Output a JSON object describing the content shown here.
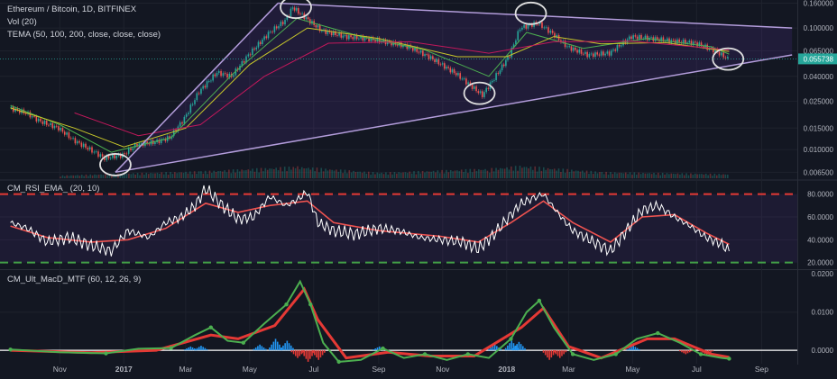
{
  "chart_data": [
    {
      "type": "line",
      "role": "price",
      "title": "Ethereum / Bitcoin, 1D, BITFINEX",
      "indicators": [
        "Vol (20)",
        "TEMA (50, 100, 200, close, close, close)"
      ],
      "scale": "log",
      "price_labels": [
        "0.160000",
        "0.100000",
        "0.065000",
        "0.040000",
        "0.025000",
        "0.015000",
        "0.010000",
        "0.006500"
      ],
      "last_price": "0.055738",
      "x_labels": [
        "Nov",
        "2017",
        "Mar",
        "May",
        "Jul",
        "Sep",
        "Nov",
        "2018",
        "Mar",
        "May",
        "Jul",
        "Sep"
      ],
      "candles": [
        [
          "2016-09-15",
          0.022
        ],
        [
          "2016-10-01",
          0.02
        ],
        [
          "2016-10-15",
          0.017
        ],
        [
          "2016-11-01",
          0.015
        ],
        [
          "2016-11-15",
          0.012
        ],
        [
          "2016-12-01",
          0.01
        ],
        [
          "2016-12-15",
          0.0085
        ],
        [
          "2017-01-01",
          0.009
        ],
        [
          "2017-01-15",
          0.011
        ],
        [
          "2017-02-01",
          0.0115
        ],
        [
          "2017-02-15",
          0.0125
        ],
        [
          "2017-03-01",
          0.018
        ],
        [
          "2017-03-15",
          0.03
        ],
        [
          "2017-04-01",
          0.043
        ],
        [
          "2017-04-15",
          0.04
        ],
        [
          "2017-05-01",
          0.06
        ],
        [
          "2017-05-20",
          0.09
        ],
        [
          "2017-06-05",
          0.115
        ],
        [
          "2017-06-12",
          0.148
        ],
        [
          "2017-06-25",
          0.12
        ],
        [
          "2017-07-10",
          0.095
        ],
        [
          "2017-08-01",
          0.085
        ],
        [
          "2017-08-20",
          0.082
        ],
        [
          "2017-09-05",
          0.078
        ],
        [
          "2017-10-01",
          0.07
        ],
        [
          "2017-10-20",
          0.058
        ],
        [
          "2017-11-15",
          0.042
        ],
        [
          "2017-12-10",
          0.028
        ],
        [
          "2017-12-25",
          0.043
        ],
        [
          "2018-01-05",
          0.06
        ],
        [
          "2018-01-15",
          0.1
        ],
        [
          "2018-02-01",
          0.11
        ],
        [
          "2018-02-15",
          0.09
        ],
        [
          "2018-03-01",
          0.07
        ],
        [
          "2018-03-20",
          0.06
        ],
        [
          "2018-04-10",
          0.062
        ],
        [
          "2018-05-01",
          0.085
        ],
        [
          "2018-05-20",
          0.082
        ],
        [
          "2018-06-10",
          0.078
        ],
        [
          "2018-07-01",
          0.075
        ],
        [
          "2018-07-20",
          0.065
        ],
        [
          "2018-08-01",
          0.0557
        ]
      ],
      "series": [
        {
          "name": "TEMA 50",
          "color": "#4caf50",
          "values": [
            [
              "2016-09-15",
              0.023
            ],
            [
              "2016-11-01",
              0.016
            ],
            [
              "2016-12-20",
              0.0095
            ],
            [
              "2017-02-15",
              0.0125
            ],
            [
              "2017-04-15",
              0.042
            ],
            [
              "2017-06-15",
              0.12
            ],
            [
              "2017-08-15",
              0.085
            ],
            [
              "2017-10-15",
              0.066
            ],
            [
              "2017-12-15",
              0.04
            ],
            [
              "2018-01-20",
              0.092
            ],
            [
              "2018-03-15",
              0.068
            ],
            [
              "2018-05-15",
              0.082
            ],
            [
              "2018-07-15",
              0.07
            ],
            [
              "2018-08-01",
              0.061
            ]
          ]
        },
        {
          "name": "TEMA 100",
          "color": "#c9c92a",
          "values": [
            [
              "2016-09-15",
              0.022
            ],
            [
              "2016-11-15",
              0.015
            ],
            [
              "2017-01-01",
              0.0105
            ],
            [
              "2017-03-01",
              0.015
            ],
            [
              "2017-05-01",
              0.05
            ],
            [
              "2017-06-25",
              0.1
            ],
            [
              "2017-09-01",
              0.082
            ],
            [
              "2017-11-15",
              0.058
            ],
            [
              "2018-01-01",
              0.058
            ],
            [
              "2018-02-15",
              0.085
            ],
            [
              "2018-04-01",
              0.074
            ],
            [
              "2018-06-01",
              0.076
            ],
            [
              "2018-08-01",
              0.064
            ]
          ]
        },
        {
          "name": "TEMA 200",
          "color": "#c2185b",
          "values": [
            [
              "2016-11-15",
              0.02
            ],
            [
              "2017-01-15",
              0.013
            ],
            [
              "2017-03-15",
              0.016
            ],
            [
              "2017-05-15",
              0.04
            ],
            [
              "2017-07-15",
              0.075
            ],
            [
              "2017-10-01",
              0.077
            ],
            [
              "2017-12-15",
              0.062
            ],
            [
              "2018-02-15",
              0.077
            ],
            [
              "2018-05-01",
              0.078
            ],
            [
              "2018-08-01",
              0.066
            ]
          ]
        }
      ],
      "volume": [
        [
          "2016-11-01",
          0.2
        ],
        [
          "2017-01-01",
          0.35
        ],
        [
          "2017-03-15",
          0.5
        ],
        [
          "2017-06-15",
          0.85
        ],
        [
          "2017-09-01",
          0.4
        ],
        [
          "2017-12-15",
          0.7
        ],
        [
          "2018-01-15",
          0.9
        ],
        [
          "2018-04-01",
          0.45
        ],
        [
          "2018-08-01",
          0.3
        ]
      ],
      "annotations": {
        "triangle": {
          "color": "#b39ddb",
          "lines": [
            {
              "from": [
                "2016-12-24",
                0.0065
              ],
              "to": [
                "2017-05-28",
                0.16
              ]
            },
            {
              "from": [
                "2017-05-28",
                0.16
              ],
              "to": [
                "2018-09-30",
                0.1
              ]
            },
            {
              "from": [
                "2016-12-24",
                0.0065
              ],
              "to": [
                "2018-09-30",
                0.06
              ]
            }
          ]
        },
        "circles": [
          [
            "2016-12-24",
            0.0075
          ],
          [
            "2017-06-14",
            0.148
          ],
          [
            "2018-01-24",
            0.132
          ],
          [
            "2017-12-06",
            0.029
          ],
          [
            "2018-07-31",
            0.0555
          ]
        ]
      }
    },
    {
      "type": "line",
      "role": "rsi",
      "title": "CM_RSI_EMA_ (20, 10)",
      "levels": [
        "80.0000",
        "60.0000",
        "40.0000",
        "20.0000"
      ],
      "overbought": 80,
      "oversold": 20,
      "ylim": [
        15,
        90
      ],
      "series": [
        {
          "name": "RSI",
          "color": "#ffffff",
          "values": [
            [
              "2016-09-15",
              55
            ],
            [
              "2016-10-01",
              50
            ],
            [
              "2016-10-20",
              38
            ],
            [
              "2016-11-10",
              42
            ],
            [
              "2016-12-01",
              35
            ],
            [
              "2016-12-20",
              30
            ],
            [
              "2017-01-05",
              48
            ],
            [
              "2017-01-25",
              42
            ],
            [
              "2017-02-10",
              55
            ],
            [
              "2017-02-25",
              60
            ],
            [
              "2017-03-10",
              70
            ],
            [
              "2017-03-20",
              85
            ],
            [
              "2017-04-05",
              70
            ],
            [
              "2017-04-20",
              58
            ],
            [
              "2017-05-05",
              60
            ],
            [
              "2017-05-20",
              78
            ],
            [
              "2017-06-05",
              70
            ],
            [
              "2017-06-15",
              75
            ],
            [
              "2017-06-25",
              82
            ],
            [
              "2017-07-05",
              55
            ],
            [
              "2017-07-20",
              48
            ],
            [
              "2017-08-10",
              45
            ],
            [
              "2017-09-01",
              50
            ],
            [
              "2017-09-20",
              48
            ],
            [
              "2017-10-10",
              42
            ],
            [
              "2017-10-30",
              40
            ],
            [
              "2017-11-20",
              38
            ],
            [
              "2017-12-05",
              32
            ],
            [
              "2017-12-20",
              45
            ],
            [
              "2018-01-05",
              62
            ],
            [
              "2018-01-15",
              72
            ],
            [
              "2018-01-25",
              76
            ],
            [
              "2018-02-05",
              80
            ],
            [
              "2018-02-20",
              62
            ],
            [
              "2018-03-05",
              48
            ],
            [
              "2018-03-25",
              38
            ],
            [
              "2018-04-10",
              30
            ],
            [
              "2018-04-25",
              48
            ],
            [
              "2018-05-10",
              66
            ],
            [
              "2018-05-25",
              70
            ],
            [
              "2018-06-10",
              60
            ],
            [
              "2018-06-25",
              52
            ],
            [
              "2018-07-10",
              42
            ],
            [
              "2018-07-25",
              36
            ],
            [
              "2018-08-01",
              30
            ]
          ]
        },
        {
          "name": "EMA",
          "color": "#ef5350",
          "values": [
            [
              "2016-09-15",
              52
            ],
            [
              "2016-10-20",
              42
            ],
            [
              "2016-12-01",
              38
            ],
            [
              "2017-01-05",
              40
            ],
            [
              "2017-02-10",
              50
            ],
            [
              "2017-03-20",
              72
            ],
            [
              "2017-04-20",
              64
            ],
            [
              "2017-05-20",
              70
            ],
            [
              "2017-06-25",
              74
            ],
            [
              "2017-07-20",
              55
            ],
            [
              "2017-09-01",
              48
            ],
            [
              "2017-10-30",
              43
            ],
            [
              "2017-12-05",
              38
            ],
            [
              "2018-01-05",
              55
            ],
            [
              "2018-02-05",
              74
            ],
            [
              "2018-03-05",
              55
            ],
            [
              "2018-04-10",
              38
            ],
            [
              "2018-05-10",
              60
            ],
            [
              "2018-06-10",
              62
            ],
            [
              "2018-07-10",
              46
            ],
            [
              "2018-08-01",
              36
            ]
          ]
        }
      ]
    },
    {
      "type": "line",
      "role": "macd",
      "title": "CM_Ult_MacD_MTF (60, 12, 26, 9)",
      "levels": [
        "0.0200",
        "0.0100",
        "0.0000"
      ],
      "ylim": [
        -0.0035,
        0.021
      ],
      "series": [
        {
          "name": "MACD",
          "color": "#4caf50",
          "values": [
            [
              "2016-09-15",
              0.0002
            ],
            [
              "2016-11-01",
              -0.0005
            ],
            [
              "2016-12-15",
              -0.0008
            ],
            [
              "2017-01-15",
              0.0004
            ],
            [
              "2017-02-15",
              0.0006
            ],
            [
              "2017-03-10",
              0.004
            ],
            [
              "2017-03-25",
              0.006
            ],
            [
              "2017-04-10",
              0.0025
            ],
            [
              "2017-04-25",
              0.002
            ],
            [
              "2017-05-15",
              0.007
            ],
            [
              "2017-06-05",
              0.012
            ],
            [
              "2017-06-18",
              0.018
            ],
            [
              "2017-06-28",
              0.012
            ],
            [
              "2017-07-10",
              0.002
            ],
            [
              "2017-07-25",
              -0.003
            ],
            [
              "2017-08-15",
              -0.0025
            ],
            [
              "2017-09-05",
              0.0005
            ],
            [
              "2017-09-25",
              -0.002
            ],
            [
              "2017-10-15",
              -0.001
            ],
            [
              "2017-11-05",
              -0.0025
            ],
            [
              "2017-11-25",
              -0.001
            ],
            [
              "2017-12-15",
              -0.002
            ],
            [
              "2018-01-05",
              0.003
            ],
            [
              "2018-01-20",
              0.01
            ],
            [
              "2018-02-01",
              0.013
            ],
            [
              "2018-02-15",
              0.006
            ],
            [
              "2018-03-05",
              -0.001
            ],
            [
              "2018-03-25",
              -0.0025
            ],
            [
              "2018-04-15",
              -0.001
            ],
            [
              "2018-05-05",
              0.003
            ],
            [
              "2018-05-25",
              0.0045
            ],
            [
              "2018-06-15",
              0.002
            ],
            [
              "2018-07-05",
              -0.001
            ],
            [
              "2018-07-25",
              -0.002
            ],
            [
              "2018-08-01",
              -0.0022
            ]
          ]
        },
        {
          "name": "Signal",
          "color": "#e53935",
          "values": [
            [
              "2016-09-15",
              0.0
            ],
            [
              "2016-12-01",
              -0.0006
            ],
            [
              "2017-02-01",
              0.0
            ],
            [
              "2017-03-25",
              0.004
            ],
            [
              "2017-04-20",
              0.003
            ],
            [
              "2017-05-25",
              0.0065
            ],
            [
              "2017-06-22",
              0.016
            ],
            [
              "2017-07-05",
              0.008
            ],
            [
              "2017-08-01",
              -0.002
            ],
            [
              "2017-09-10",
              -0.0005
            ],
            [
              "2017-10-20",
              -0.0015
            ],
            [
              "2017-12-01",
              -0.0015
            ],
            [
              "2018-01-15",
              0.006
            ],
            [
              "2018-02-05",
              0.011
            ],
            [
              "2018-03-01",
              0.001
            ],
            [
              "2018-04-01",
              -0.002
            ],
            [
              "2018-05-15",
              0.003
            ],
            [
              "2018-06-10",
              0.003
            ],
            [
              "2018-07-15",
              -0.001
            ],
            [
              "2018-08-01",
              -0.0018
            ]
          ]
        }
      ],
      "histogram": [
        [
          "2017-03-05",
          0.001
        ],
        [
          "2017-03-15",
          0.0012
        ],
        [
          "2017-05-10",
          0.0015
        ],
        [
          "2017-05-25",
          0.003
        ],
        [
          "2017-06-05",
          0.0025
        ],
        [
          "2017-06-15",
          -0.002
        ],
        [
          "2017-06-25",
          -0.003
        ],
        [
          "2017-07-05",
          -0.0025
        ],
        [
          "2017-09-01",
          0.001
        ],
        [
          "2017-12-20",
          0.0015
        ],
        [
          "2018-01-05",
          0.0025
        ],
        [
          "2018-01-12",
          0.0022
        ],
        [
          "2018-02-10",
          -0.0025
        ],
        [
          "2018-02-20",
          -0.002
        ],
        [
          "2018-05-01",
          0.0012
        ],
        [
          "2018-06-20",
          -0.001
        ],
        [
          "2018-07-10",
          -0.0012
        ]
      ]
    }
  ]
}
